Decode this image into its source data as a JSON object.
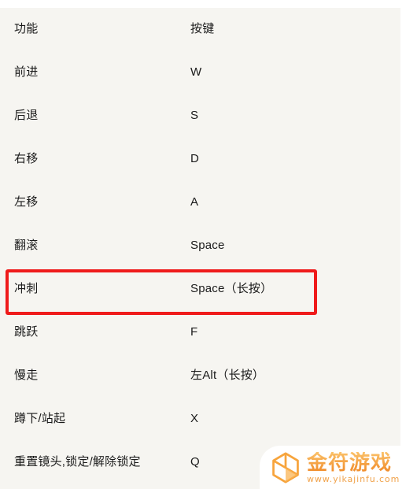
{
  "colors": {
    "page_background": "#ffffff",
    "content_background": "#f6f5f1",
    "text": "#1a1a1a",
    "annotation_red": "#ef1b1b",
    "watermark_orange": "#f08a28"
  },
  "table": {
    "columns": [
      "功能",
      "按键"
    ],
    "rows": [
      {
        "function": "功能",
        "key": "按键"
      },
      {
        "function": "前进",
        "key": "W"
      },
      {
        "function": "后退",
        "key": "S"
      },
      {
        "function": "右移",
        "key": "D"
      },
      {
        "function": "左移",
        "key": "A"
      },
      {
        "function": "翻滚",
        "key": "Space"
      },
      {
        "function": "冲刺",
        "key": "Space（长按）"
      },
      {
        "function": "跳跃",
        "key": "F"
      },
      {
        "function": "慢走",
        "key": "左Alt（长按）"
      },
      {
        "function": "蹲下/站起",
        "key": "X"
      },
      {
        "function": "重置镜头,锁定/解除锁定",
        "key": "Q"
      }
    ]
  },
  "annotation": {
    "highlighted_row_index": 6,
    "highlighted_function": "冲刺",
    "highlighted_key": "Space（长按）"
  },
  "watermark": {
    "icon": "cube-icon",
    "title": "金符游戏",
    "url": "www.yikajinfu.com"
  }
}
